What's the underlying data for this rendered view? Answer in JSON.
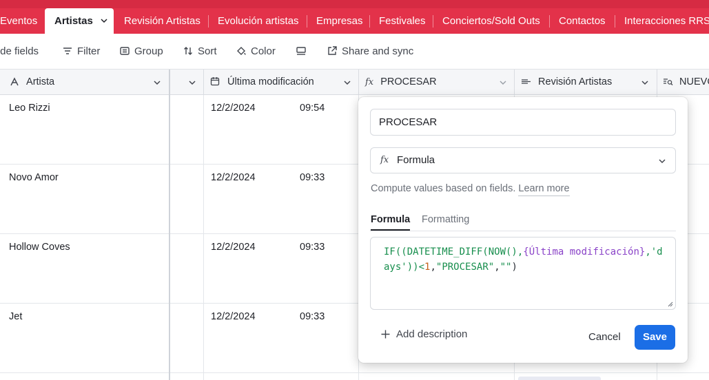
{
  "tabs": [
    {
      "label": "Eventos"
    },
    {
      "label": "Artistas",
      "active": true
    },
    {
      "label": "Revisión Artistas"
    },
    {
      "label": "Evolución artistas"
    },
    {
      "label": "Empresas"
    },
    {
      "label": "Festivales"
    },
    {
      "label": "Conciertos/Sold Outs"
    },
    {
      "label": "Contactos"
    },
    {
      "label": "Interacciones RRSS"
    }
  ],
  "toolbar": {
    "hide_fields": "Hide fields",
    "filter": "Filter",
    "group": "Group",
    "sort": "Sort",
    "color": "Color",
    "share": "Share and sync"
  },
  "columns": {
    "artista": "Artista",
    "ultima": "Última modificación",
    "procesar": "PROCESAR",
    "revision": "Revisión Artistas",
    "nuevo": "NUEVO"
  },
  "rows": [
    {
      "artista": "Leo Rizzi",
      "date": "12/2/2024",
      "time": "09:54"
    },
    {
      "artista": "Novo Amor",
      "date": "12/2/2024",
      "time": "09:33"
    },
    {
      "artista": "Hollow Coves",
      "date": "12/2/2024",
      "time": "09:33"
    },
    {
      "artista": "Jet",
      "date": "12/2/2024",
      "time": "09:33"
    }
  ],
  "editor": {
    "field_name": "PROCESAR",
    "field_type": "Formula",
    "help_text": "Compute values based on fields.",
    "learn_more": "Learn more",
    "tab_formula": "Formula",
    "tab_formatting": "Formatting",
    "formula": {
      "t1": "IF((DATETIME_DIFF(NOW(),",
      "t2": "{Última modificación}",
      "t3": ",'days'))<",
      "t4": "1",
      "t5": ",",
      "t6": "\"PROCESAR\"",
      "t7": ",",
      "t8": "\"\"",
      "t9": ")"
    },
    "add_description": "Add description",
    "cancel": "Cancel",
    "save": "Save"
  },
  "colors": {
    "tabbar": "#e3324a",
    "save_button": "#1b6ee6",
    "formula_keyword": "#178e4d",
    "formula_field": "#8a43c8",
    "formula_number": "#c4621b"
  }
}
